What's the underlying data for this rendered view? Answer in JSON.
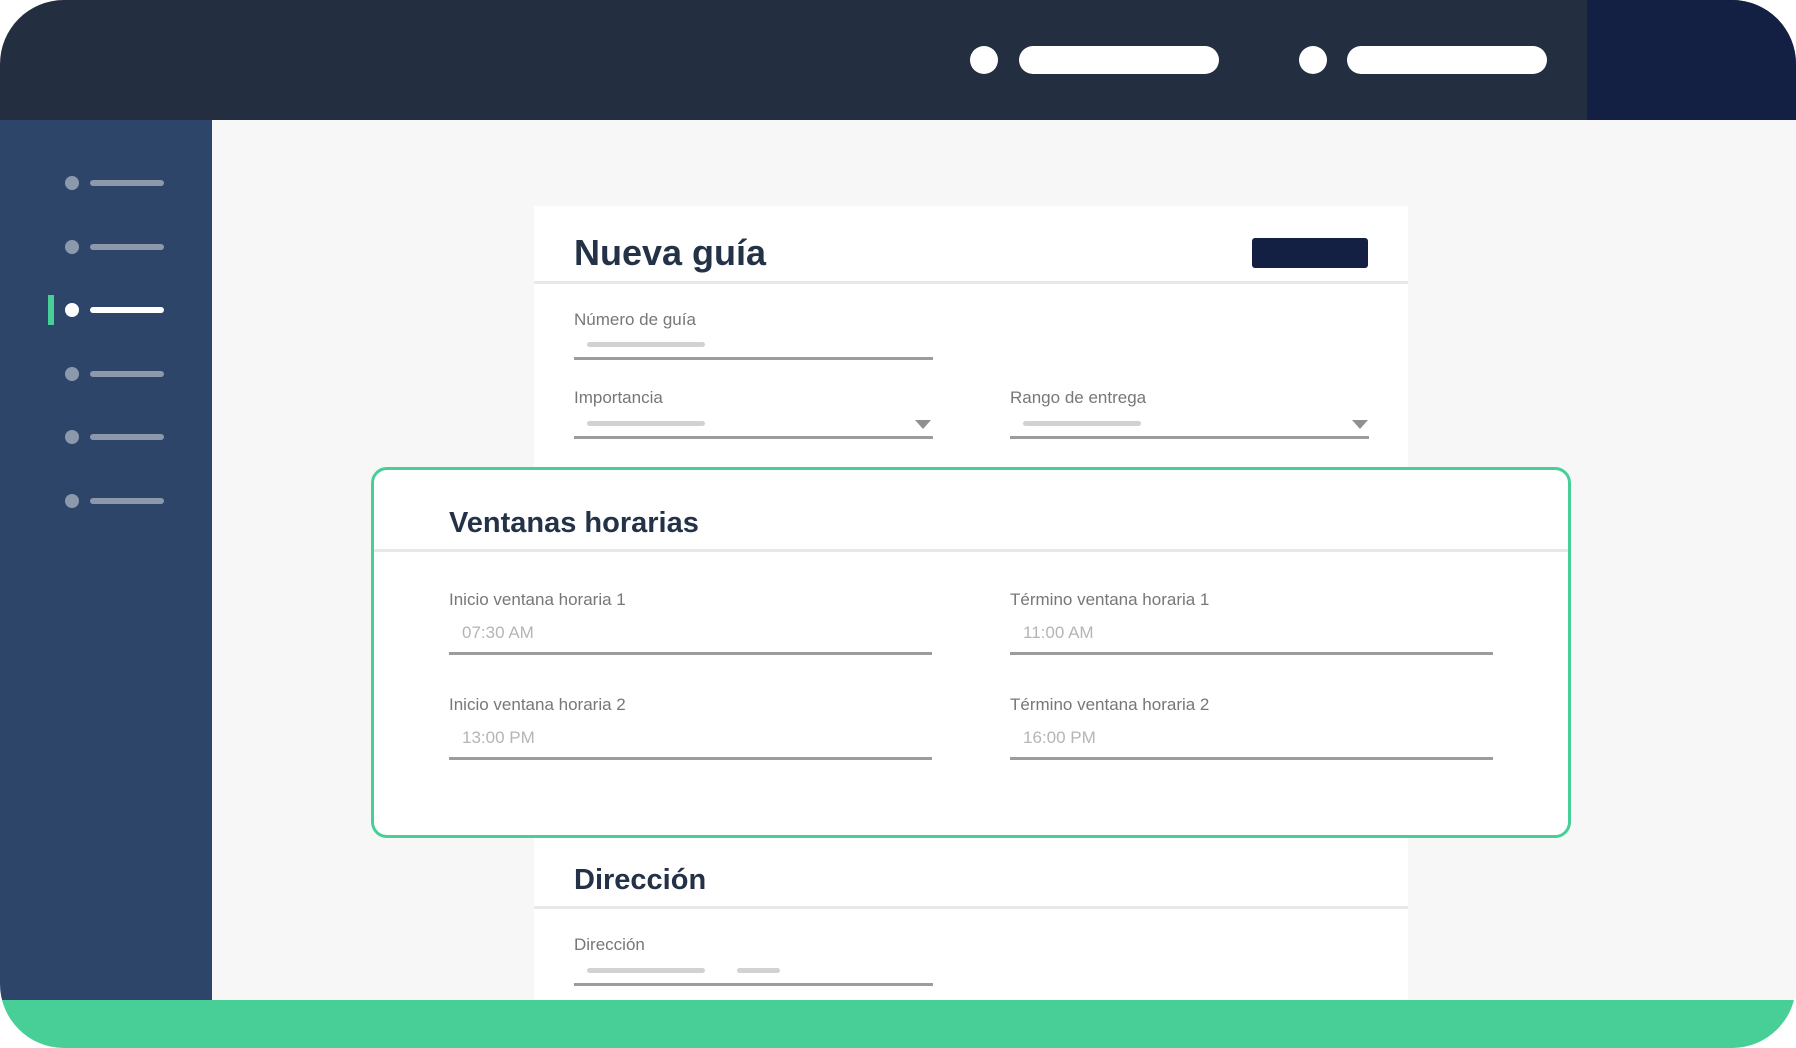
{
  "colors": {
    "topbar": "#232e41",
    "sidebar": "#2c4569",
    "accent": "#48cf98",
    "primary_button": "#141f44"
  },
  "form": {
    "title": "Nueva guía",
    "fields": {
      "numero_guia_label": "Número de guía",
      "importancia_label": "Importancia",
      "rango_entrega_label": "Rango de entrega"
    }
  },
  "time_windows": {
    "title": "Ventanas horarias",
    "fields": [
      {
        "label": "Inicio ventana horaria 1",
        "value": "07:30 AM"
      },
      {
        "label": "Término ventana horaria 1",
        "value": "11:00 AM"
      },
      {
        "label": "Inicio ventana horaria 2",
        "value": "13:00 PM"
      },
      {
        "label": "Término ventana horaria 2",
        "value": "16:00 PM"
      }
    ]
  },
  "address": {
    "title": "Dirección",
    "field_label": "Dirección"
  }
}
